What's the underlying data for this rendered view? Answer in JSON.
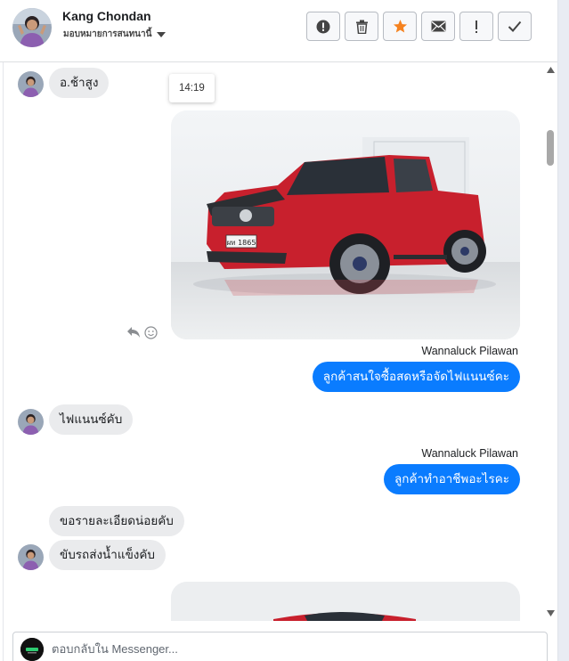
{
  "header": {
    "contact_name": "Kang Chondan",
    "assign_label": "มอบหมายการสนทนานี้",
    "buttons": [
      {
        "name": "report-button",
        "icon": "exclamation-circle-icon"
      },
      {
        "name": "delete-button",
        "icon": "trash-icon"
      },
      {
        "name": "star-button",
        "icon": "star-icon"
      },
      {
        "name": "mark-unread-button",
        "icon": "envelope-icon"
      },
      {
        "name": "priority-button",
        "icon": "exclamation-icon"
      },
      {
        "name": "mark-done-button",
        "icon": "checkmark-icon"
      }
    ]
  },
  "colors": {
    "outgoing_bubble": "#0a7cff",
    "incoming_bubble": "#eaebed",
    "star": "#f5821f"
  },
  "messages": {
    "m1": {
      "text": "อ.ช้าสูง"
    },
    "timestamp": "14:19",
    "m2_sender": "Wannaluck Pilawan",
    "m2": {
      "text": "ลูกค้าสนใจซื้อสดหรือจัดไฟแนนซ์คะ"
    },
    "m3": {
      "text": "ไฟแนนซ์คับ"
    },
    "m4_sender": "Wannaluck Pilawan",
    "m4": {
      "text": "ลูกค้าทำอาชีพอะไรคะ"
    },
    "m5": {
      "text": "ขอรายละเอียดน่อยคับ"
    },
    "m6": {
      "text": "ขับรถส่งน้ำแข็งคับ"
    },
    "photo_plate": "ผท 1865"
  },
  "composer": {
    "placeholder": "ตอบกลับใน Messenger..."
  }
}
